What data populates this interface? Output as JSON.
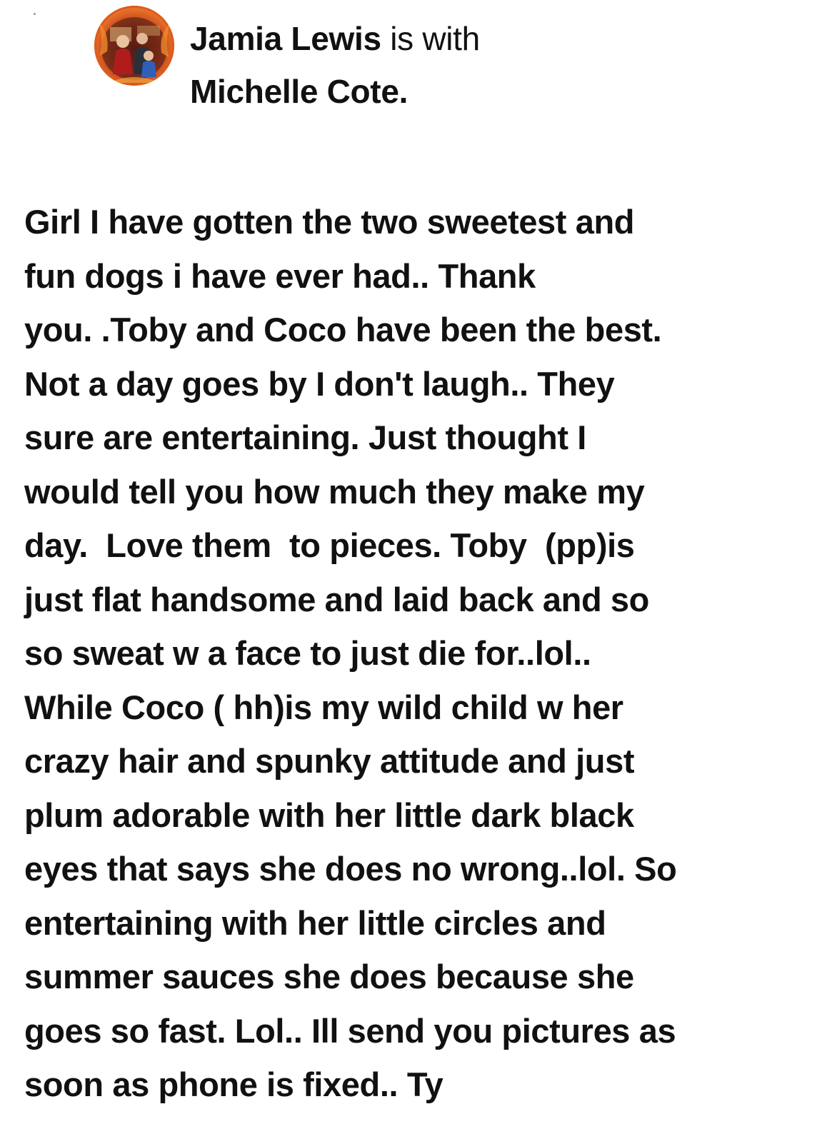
{
  "post": {
    "author": "Jamia Lewis",
    "connector": "is with",
    "tagged": "Michelle Cote",
    "tagged_suffix": ".",
    "avatar_icon": "profile-photo-avatar",
    "body_lines": [
      "Girl I have gotten the two sweetest and",
      "fun dogs i have ever had.. Thank",
      "you. .Toby and Coco have been the best.",
      "Not a day goes by I don't laugh.. They",
      "sure are entertaining. Just thought I",
      "would tell you how much they make my",
      "day.  Love them  to pieces. Toby  (pp)is",
      "just flat handsome and laid back and so",
      "so sweat w a face to just die for..lol..",
      "While Coco ( hh)is my wild child w her",
      "crazy hair and spunky attitude and just",
      "plum adorable with her little dark black",
      "eyes that says she does no wrong..lol. So",
      "entertaining with her little circles and",
      "summer sauces she does because she",
      "goes so fast. Lol.. Ill send you pictures as",
      "soon as phone is fixed.. Ty"
    ]
  },
  "colors": {
    "text": "#111111",
    "background": "#ffffff",
    "avatar_ring": "#e05a1c"
  }
}
